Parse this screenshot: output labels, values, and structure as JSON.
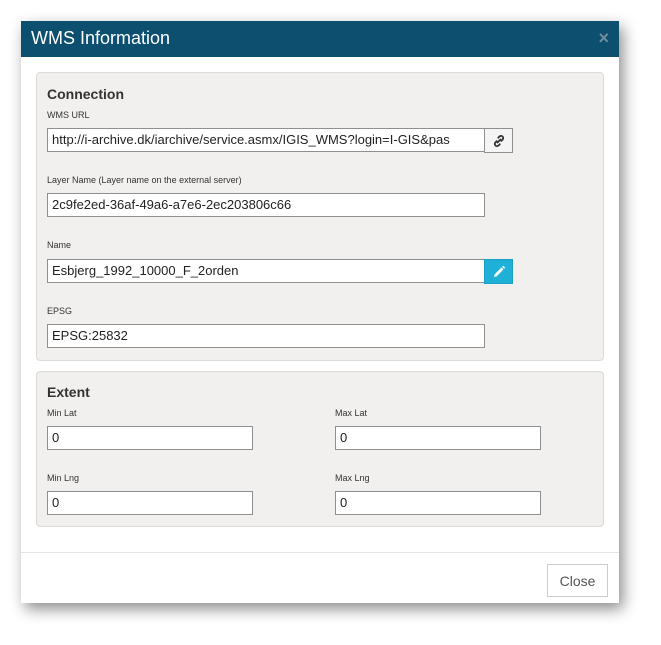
{
  "dialog": {
    "title": "WMS Information",
    "close_glyph": "×"
  },
  "connection": {
    "title": "Connection",
    "wms_url": {
      "label": "WMS URL",
      "value": "http://i-archive.dk/iarchive/service.asmx/IGIS_WMS?login=I-GIS&pas",
      "button_icon": "link-icon"
    },
    "layer_name": {
      "label": "Layer Name (Layer name on the external server)",
      "value": "2c9fe2ed-36af-49a6-a7e6-2ec203806c66"
    },
    "name": {
      "label": "Name",
      "value": "Esbjerg_1992_10000_F_2orden",
      "button_icon": "pencil-icon"
    },
    "epsg": {
      "label": "EPSG",
      "value": "EPSG:25832"
    }
  },
  "extent": {
    "title": "Extent",
    "min_lat": {
      "label": "Min Lat",
      "value": "0"
    },
    "max_lat": {
      "label": "Max Lat",
      "value": "0"
    },
    "min_lng": {
      "label": "Min Lng",
      "value": "0"
    },
    "max_lng": {
      "label": "Max Lng",
      "value": "0"
    }
  },
  "footer": {
    "close_label": "Close"
  },
  "colors": {
    "header_bg": "#0c4f6e",
    "edit_button_bg": "#1fb0d8",
    "panel_bg": "#f1f0ef"
  }
}
